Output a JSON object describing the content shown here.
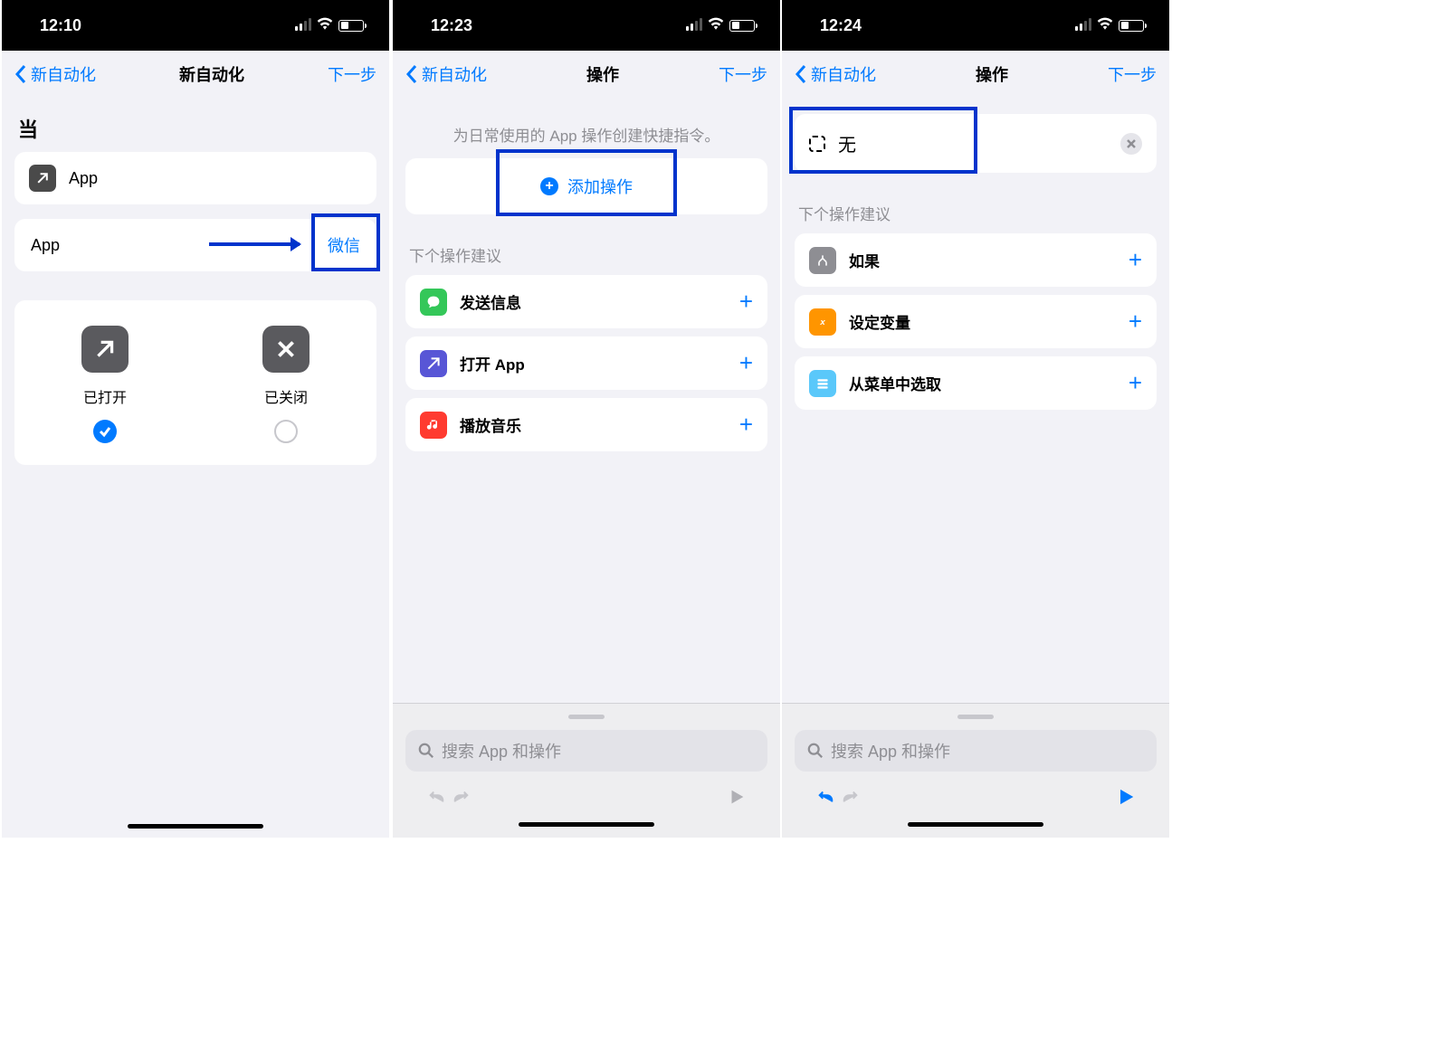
{
  "screen1": {
    "time": "12:10",
    "nav": {
      "back": "新自动化",
      "title": "新自动化",
      "next": "下一步"
    },
    "when_label": "当",
    "app_label": "App",
    "selector_label": "App",
    "selector_value": "微信",
    "opened_label": "已打开",
    "closed_label": "已关闭"
  },
  "screen2": {
    "time": "12:23",
    "nav": {
      "back": "新自动化",
      "title": "操作",
      "next": "下一步"
    },
    "hint": "为日常使用的 App 操作创建快捷指令。",
    "add_action": "添加操作",
    "suggest_label": "下个操作建议",
    "suggestions": [
      {
        "label": "发送信息",
        "color": "green"
      },
      {
        "label": "打开 App",
        "color": "purple"
      },
      {
        "label": "播放音乐",
        "color": "red"
      }
    ],
    "search_placeholder": "搜索 App 和操作"
  },
  "screen3": {
    "time": "12:24",
    "nav": {
      "back": "新自动化",
      "title": "操作",
      "next": "下一步"
    },
    "action_none": "无",
    "suggest_label": "下个操作建议",
    "suggestions": [
      {
        "label": "如果",
        "color": "gray"
      },
      {
        "label": "设定变量",
        "color": "orange"
      },
      {
        "label": "从菜单中选取",
        "color": "teal"
      }
    ],
    "search_placeholder": "搜索 App 和操作"
  }
}
